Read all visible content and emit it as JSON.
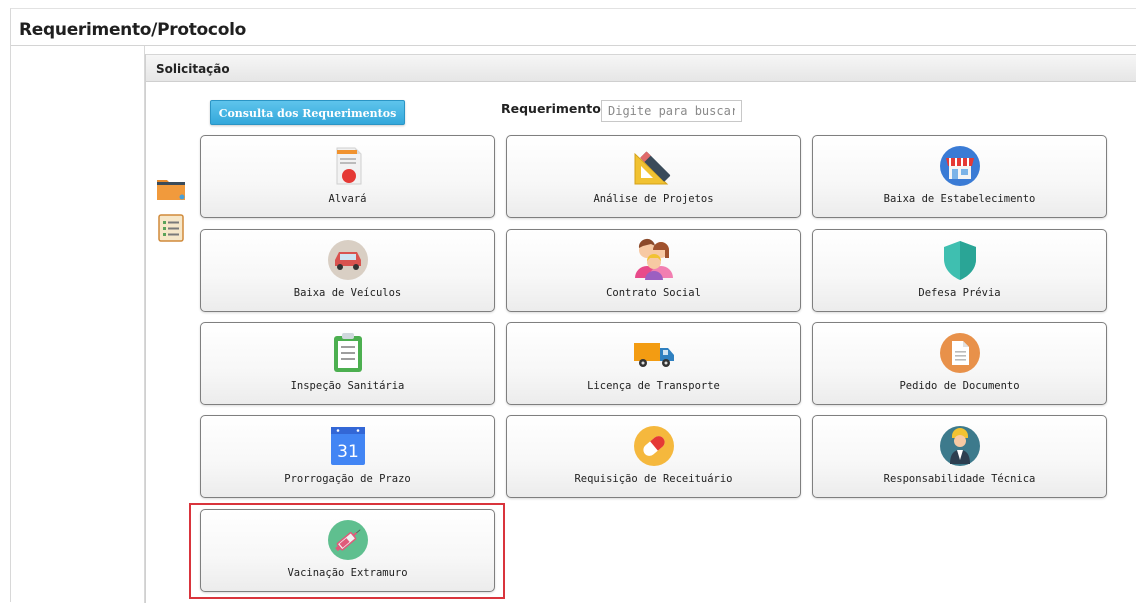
{
  "page": {
    "title": "Requerimento/Protocolo"
  },
  "panel": {
    "title": "Solicitação"
  },
  "toolbar": {
    "consult_label": "Consulta dos Requerimentos",
    "search_label": "Requerimento",
    "search_placeholder": "Digite para buscar..."
  },
  "side_icons": [
    {
      "name": "folder-icon"
    },
    {
      "name": "checklist-icon"
    }
  ],
  "tiles": [
    {
      "label": "Alvará",
      "icon": "permit-document-icon"
    },
    {
      "label": "Análise de Projetos",
      "icon": "ruler-pencil-icon"
    },
    {
      "label": "Baixa de Estabelecimento",
      "icon": "storefront-icon"
    },
    {
      "label": "Baixa de Veículos",
      "icon": "car-icon"
    },
    {
      "label": "Contrato Social",
      "icon": "people-icon"
    },
    {
      "label": "Defesa Prévia",
      "icon": "shield-icon"
    },
    {
      "label": "Inspeção Sanitária",
      "icon": "clipboard-icon"
    },
    {
      "label": "Licença de Transporte",
      "icon": "truck-icon"
    },
    {
      "label": "Pedido de Documento",
      "icon": "document-icon"
    },
    {
      "label": "Prorrogação de Prazo",
      "icon": "calendar-icon",
      "day": "31"
    },
    {
      "label": "Requisição de Receituário",
      "icon": "pill-icon"
    },
    {
      "label": "Responsabilidade Técnica",
      "icon": "engineer-icon"
    },
    {
      "label": "Vacinação Extramuro",
      "icon": "syringe-icon"
    }
  ],
  "colors": {
    "accent": "#3aaee0",
    "highlight": "#d9343c"
  }
}
